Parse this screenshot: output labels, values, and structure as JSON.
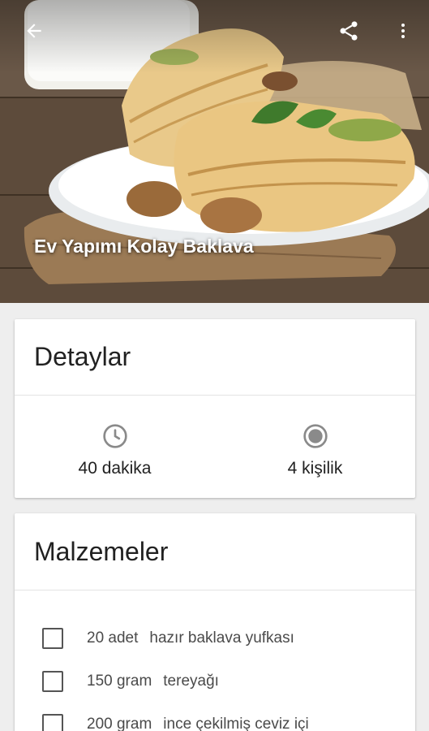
{
  "recipe": {
    "title": "Ev Yapımı Kolay Baklava"
  },
  "details": {
    "heading": "Detaylar",
    "duration": "40 dakika",
    "servings": "4 kişilik"
  },
  "ingredients": {
    "heading": "Malzemeler",
    "items": [
      {
        "amount": "20 adet",
        "name": "hazır baklava yufkası"
      },
      {
        "amount": "150 gram",
        "name": "tereyağı"
      },
      {
        "amount": "200 gram",
        "name": "ince çekilmiş ceviz içi"
      }
    ]
  },
  "icons": {
    "back": "arrow-back-icon",
    "share": "share-icon",
    "more": "more-vert-icon",
    "duration": "clock-icon",
    "servings": "radio-dot-icon"
  },
  "colors": {
    "background": "#eeeeee",
    "card": "#ffffff",
    "icon_gray": "#8a8a8a",
    "text_primary": "#212121",
    "text_secondary": "#4a4a4a"
  }
}
